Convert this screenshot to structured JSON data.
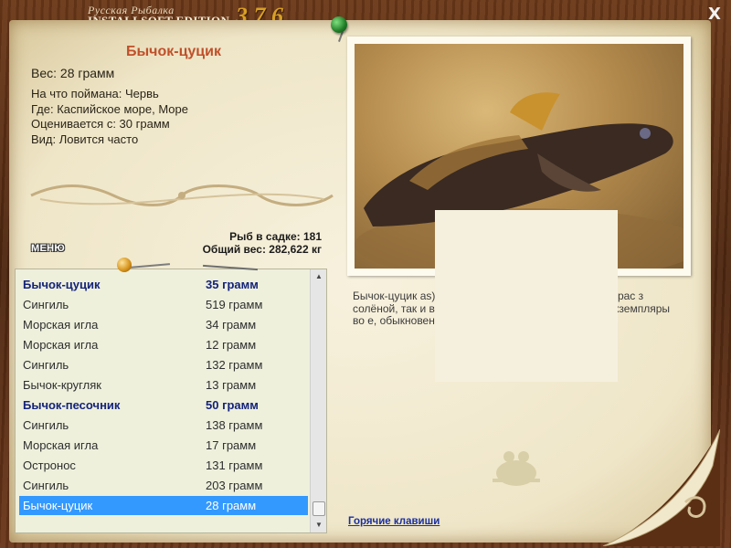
{
  "window": {
    "title_ru": "Русская Рыбалка",
    "title_edition": "INSTALLSOFT EDITION",
    "version": "3.7.6",
    "close_label": "X"
  },
  "fish": {
    "name": "Бычок-цуцик",
    "weight_line": "Вес: 28 грамм",
    "bait_line": "На что поймана: Червь",
    "place_line": "Где: Каспийское море, Море",
    "value_line": "Оценивается с: 30 грамм",
    "species_line": "Вид: Ловится часто"
  },
  "stats": {
    "count_line": "Рыб в садке: 181",
    "total_line": "Общий вес: 282,622 кг"
  },
  "menu": {
    "label": "МЕНЮ"
  },
  "description": {
    "text": "Бычок-цуцик                                          as) - рыба семейства быч                                          а обширное рас                                          з солёной, так и в пресно                                        лийском море, в устьях                                            е экземпляры во                                               е, обыкновенная                                               мм."
  },
  "hotkeys": {
    "label": "Горячие клавиши"
  },
  "catch_list": {
    "items": [
      {
        "name": "Бычок-цуцик",
        "weight": "35 грамм",
        "bold": true
      },
      {
        "name": "Сингиль",
        "weight": "519 грамм",
        "bold": false
      },
      {
        "name": "Морская игла",
        "weight": "34 грамм",
        "bold": false
      },
      {
        "name": "Морская игла",
        "weight": "12 грамм",
        "bold": false
      },
      {
        "name": "Сингиль",
        "weight": "132 грамм",
        "bold": false
      },
      {
        "name": "Бычок-кругляк",
        "weight": "13 грамм",
        "bold": false
      },
      {
        "name": "Бычок-песочник",
        "weight": "50 грамм",
        "bold": true
      },
      {
        "name": "Сингиль",
        "weight": "138 грамм",
        "bold": false
      },
      {
        "name": "Морская игла",
        "weight": "17 грамм",
        "bold": false
      },
      {
        "name": "Остронос",
        "weight": "131 грамм",
        "bold": false
      },
      {
        "name": "Сингиль",
        "weight": "203 грамм",
        "bold": false
      },
      {
        "name": "Бычок-цуцик",
        "weight": "28 грамм",
        "bold": false,
        "selected": true
      }
    ],
    "scroll_arrows": {
      "up": "▲",
      "down": "▼"
    }
  },
  "colors": {
    "fish_name": "#c0502a",
    "list_bold": "#14237a",
    "selection": "#3399ff",
    "link": "#1a2fa0",
    "version": "#d9a023"
  }
}
